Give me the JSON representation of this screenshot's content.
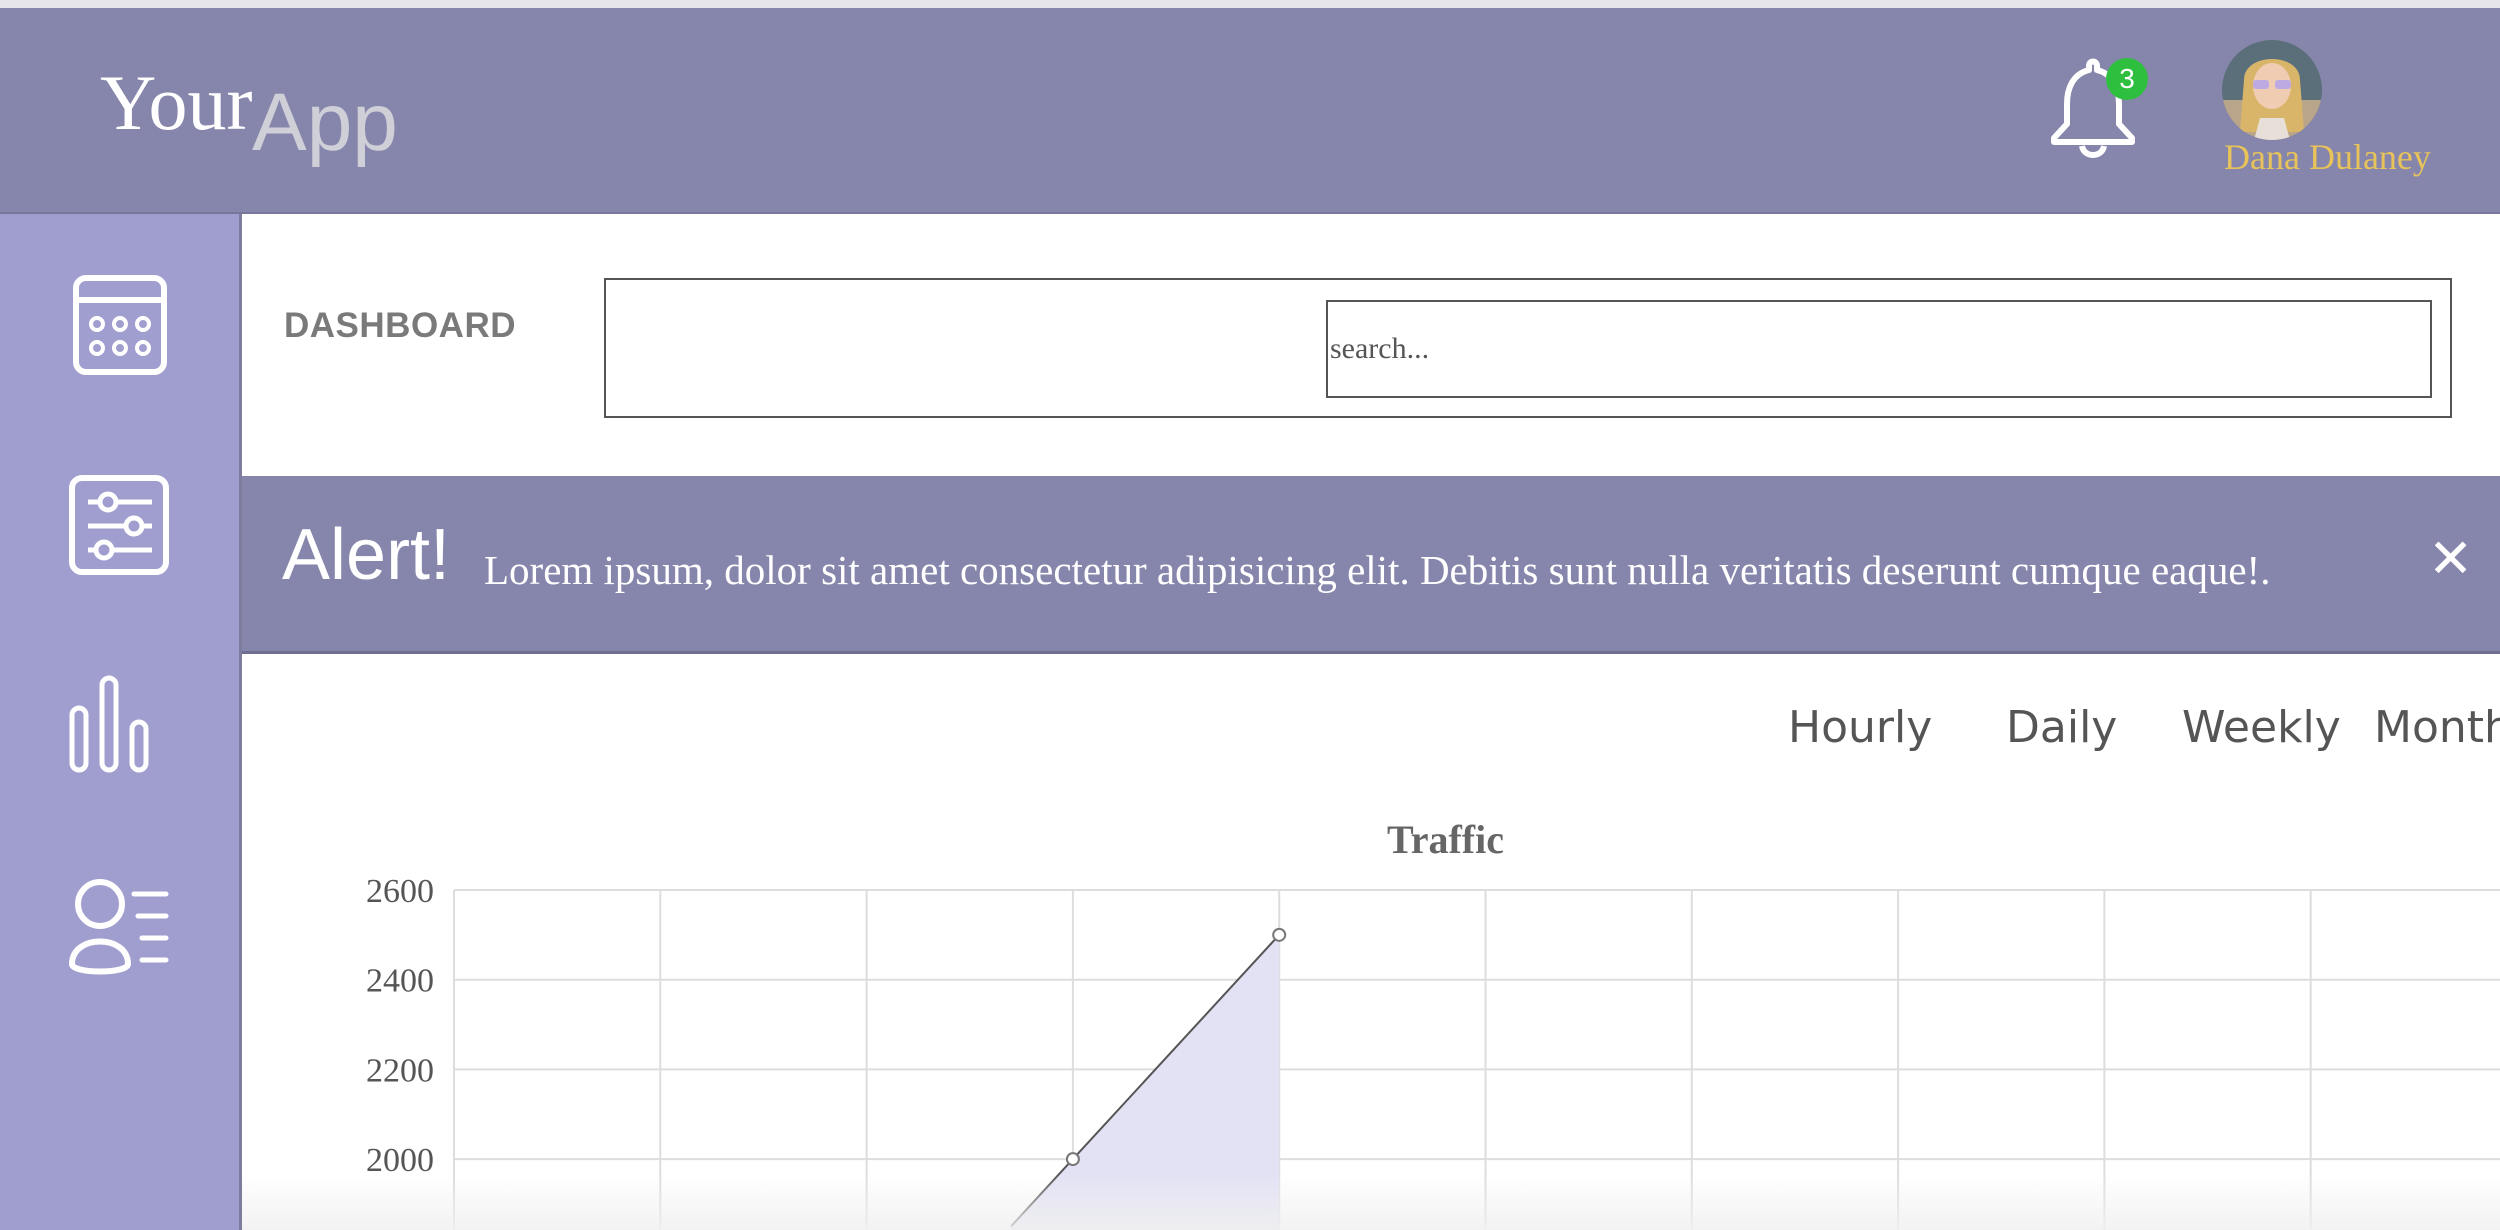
{
  "header": {
    "logo_primary": "Your",
    "logo_secondary": "App",
    "notification_count": "3",
    "user_name": "Dana Dulaney"
  },
  "sidebar": {
    "items": [
      {
        "icon": "calendar-icon"
      },
      {
        "icon": "sliders-icon"
      },
      {
        "icon": "bar-chart-icon"
      },
      {
        "icon": "user-list-icon"
      }
    ]
  },
  "main": {
    "title": "DASHBOARD",
    "search_placeholder": "search...",
    "alert": {
      "title": "Alert!",
      "message": "Lorem ipsum, dolor sit amet consectetur adipisicing elit. Debitis sunt nulla veritatis deserunt cumque eaque!.",
      "close_glyph": "✕"
    },
    "tabs": [
      "Hourly",
      "Daily",
      "Weekly",
      "Month"
    ]
  },
  "colors": {
    "header_bg": "#8685ab",
    "sidebar_bg": "#a09ecf",
    "badge": "#2fbf3f",
    "user_name": "#e8c35a",
    "chart_fill": "#e3e2f5",
    "chart_line": "#555555"
  },
  "chart_data": {
    "type": "area",
    "title": "Traffic",
    "yticks": [
      "2600",
      "2400",
      "2200",
      "2000"
    ],
    "ylim": [
      1800,
      2600
    ],
    "grid": true,
    "points": [
      {
        "index": 2.7,
        "value": 1850
      },
      {
        "index": 3,
        "value": 2000
      },
      {
        "index": 4,
        "value": 2500
      }
    ]
  }
}
